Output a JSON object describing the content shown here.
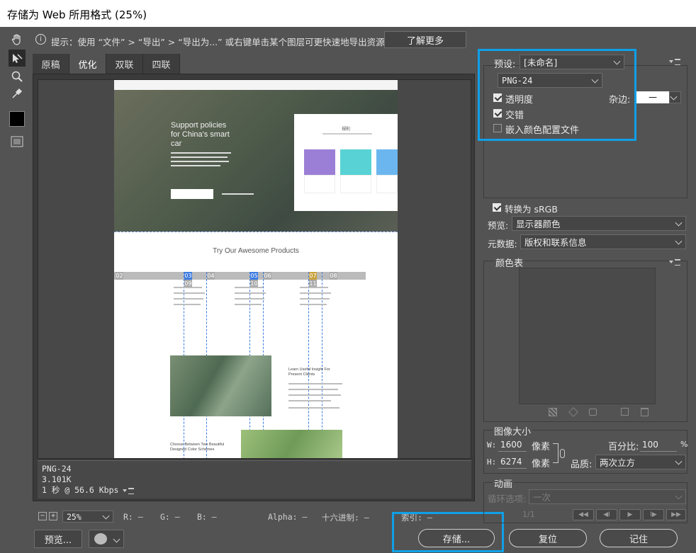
{
  "window": {
    "title": "存储为 Web 所用格式 (25%)"
  },
  "tools": [
    "hand-tool-icon",
    "slice-select-tool-icon",
    "zoom-tool-icon",
    "eyedropper-tool-icon",
    "eyedropper-color-swatch",
    "toggle-slices-icon"
  ],
  "hint": {
    "text": "提示：使用 “文件” > “导出” > “导出为...” 或右键单击某个图层可更快速地导出资源",
    "learn_more": "了解更多"
  },
  "tabs": [
    {
      "label": "原稿"
    },
    {
      "label": "优化"
    },
    {
      "label": "双联"
    },
    {
      "label": "四联"
    }
  ],
  "preview_page": {
    "hero_line1": "Support policies",
    "hero_line2": "for China's smart",
    "hero_line3": "car",
    "card_title": "規則",
    "section_title": "Try Our Awesome Products",
    "feature_title_1": "Learn Useful Insight For",
    "feature_title_2": "Present Clients",
    "feature_title_3": "Choose Between Two Beautiful",
    "feature_title_4": "Designed Color Schemes",
    "slices": [
      "02",
      "03",
      "04",
      "05",
      "06",
      "07",
      "08",
      "09",
      "10",
      "11"
    ]
  },
  "info": {
    "format": "PNG-24",
    "size": "3.101K",
    "time": "1 秒 @ 56.6 Kbps"
  },
  "status": {
    "zoom": "25%",
    "r": "R: —",
    "g": "G: —",
    "b": "B: —",
    "alpha": "Alpha: —",
    "hex": "十六进制: —",
    "index": "索引: —"
  },
  "bottom": {
    "preview_btn": "预览...",
    "save_btn": "存储...",
    "reset_btn": "复位",
    "remember_btn": "记住"
  },
  "settings": {
    "preset_label": "预设:",
    "preset_value": "[未命名]",
    "format_value": "PNG-24",
    "transparency": "透明度",
    "transparency_checked": true,
    "matte_label": "杂边:",
    "matte_value": "—",
    "interlaced": "交错",
    "interlaced_checked": true,
    "embed_profile": "嵌入颜色配置文件",
    "embed_checked": false,
    "convert_srgb": "转换为 sRGB",
    "convert_checked": true,
    "preview_label": "预览:",
    "preview_value": "显示器颜色",
    "metadata_label": "元数据:",
    "metadata_value": "版权和联系信息"
  },
  "color_table": {
    "title": "颜色表"
  },
  "image_size": {
    "title": "图像大小",
    "w_label": "W:",
    "w_value": "1600",
    "h_label": "H:",
    "h_value": "6274",
    "unit": "像素",
    "percent_label": "百分比:",
    "percent_value": "100",
    "percent_unit": "%",
    "quality_label": "品质:",
    "quality_value": "两次立方"
  },
  "animation": {
    "title": "动画",
    "loop_label": "循环选项:",
    "loop_value": "一次",
    "frame": "1/1"
  },
  "colors": {
    "highlight": "#0fa0e8",
    "panel_bg": "#535353",
    "slice_active": "#3d7be0"
  }
}
